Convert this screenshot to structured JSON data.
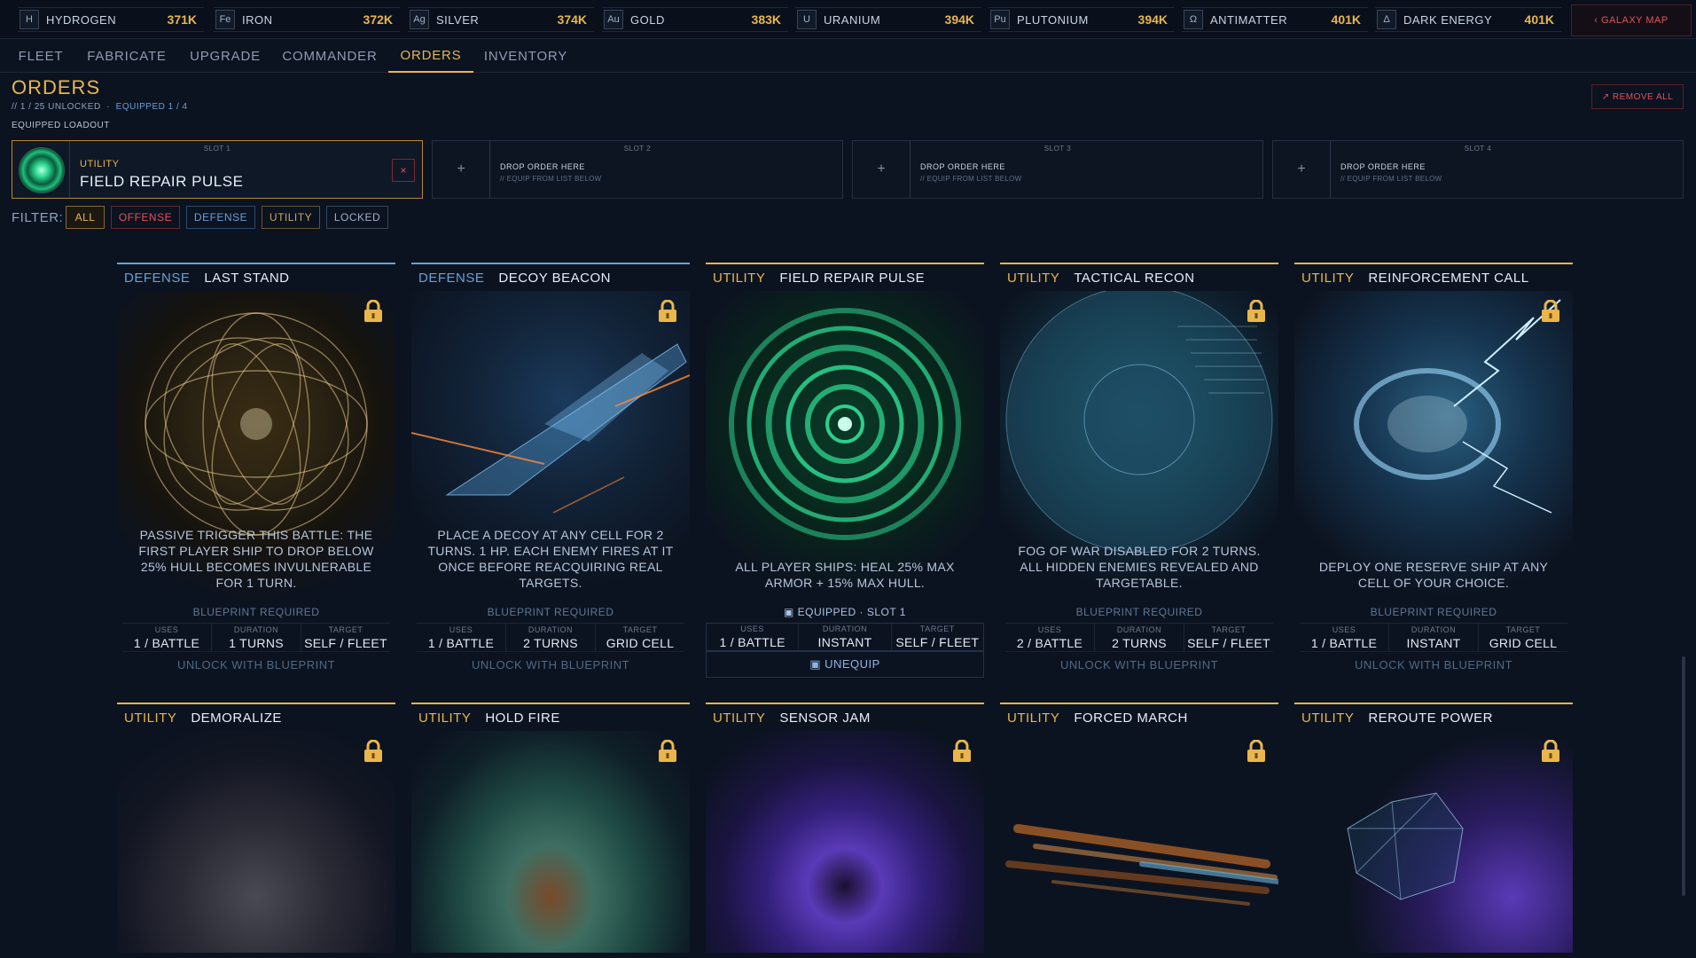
{
  "resources": [
    {
      "sym": "H",
      "name": "HYDROGEN",
      "value": "371K"
    },
    {
      "sym": "Fe",
      "name": "IRON",
      "value": "372K"
    },
    {
      "sym": "Ag",
      "name": "SILVER",
      "value": "374K"
    },
    {
      "sym": "Au",
      "name": "GOLD",
      "value": "383K"
    },
    {
      "sym": "U",
      "name": "URANIUM",
      "value": "394K"
    },
    {
      "sym": "Pu",
      "name": "PLUTONIUM",
      "value": "394K"
    },
    {
      "sym": "Ω",
      "name": "ANTIMATTER",
      "value": "401K"
    },
    {
      "sym": "Δ",
      "name": "DARK ENERGY",
      "value": "401K"
    }
  ],
  "galaxy_map_label": "‹ GALAXY MAP",
  "tabs": [
    "FLEET",
    "FABRICATE",
    "UPGRADE",
    "COMMANDER",
    "ORDERS",
    "INVENTORY"
  ],
  "active_tab": "ORDERS",
  "page": {
    "title": "ORDERS",
    "unlocked": "// 1 / 25 UNLOCKED",
    "sep": "·",
    "equipped": "EQUIPPED 1 / 4",
    "loadout_label": "EQUIPPED LOADOUT",
    "remove_all": "↗ REMOVE ALL"
  },
  "slots": [
    {
      "num": "SLOT 1",
      "type": "UTILITY",
      "name": "FIELD REPAIR PULSE",
      "remove": "×"
    },
    {
      "num": "SLOT 2",
      "plus": "+",
      "drop": "DROP ORDER HERE",
      "hint": "// EQUIP FROM LIST BELOW"
    },
    {
      "num": "SLOT 3",
      "plus": "+",
      "drop": "DROP ORDER HERE",
      "hint": "// EQUIP FROM LIST BELOW"
    },
    {
      "num": "SLOT 4",
      "plus": "+",
      "drop": "DROP ORDER HERE",
      "hint": "// EQUIP FROM LIST BELOW"
    }
  ],
  "filter": {
    "label": "FILTER:",
    "options": [
      "ALL",
      "OFFENSE",
      "DEFENSE",
      "UTILITY",
      "LOCKED"
    ],
    "active": "ALL"
  },
  "stat_labels": {
    "uses": "USES",
    "duration": "DURATION",
    "target": "TARGET"
  },
  "blueprint_required": "BLUEPRINT REQUIRED",
  "unlock_label": "UNLOCK WITH BLUEPRINT",
  "equipped_label": "▣ EQUIPPED · SLOT 1",
  "unequip_label": "▣ UNEQUIP",
  "colors": {
    "accent": "#e8b64c",
    "defense": "#6aa0d8",
    "utility": "#e8b64c",
    "danger": "#e0525c",
    "background": "#0b1220"
  },
  "cards_row1": [
    {
      "type": "DEFENSE",
      "title": "LAST STAND",
      "locked": true,
      "art": "golden-sphere",
      "desc": "PASSIVE TRIGGER THIS BATTLE: THE FIRST PLAYER SHIP TO DROP BELOW 25% HULL BECOMES INVULNERABLE FOR 1 TURN.",
      "uses": "1 / BATTLE",
      "duration": "1 TURNS",
      "target": "SELF / FLEET"
    },
    {
      "type": "DEFENSE",
      "title": "DECOY BEACON",
      "locked": true,
      "art": "holographic-ship",
      "desc": "PLACE A DECOY AT ANY CELL FOR 2 TURNS. 1 HP. EACH ENEMY FIRES AT IT ONCE BEFORE REACQUIRING REAL TARGETS.",
      "uses": "1 / BATTLE",
      "duration": "2 TURNS",
      "target": "GRID CELL"
    },
    {
      "type": "UTILITY",
      "title": "FIELD REPAIR PULSE",
      "locked": false,
      "equipped": true,
      "art": "green-pulse",
      "desc": "ALL PLAYER SHIPS: HEAL 25% MAX ARMOR + 15% MAX HULL.",
      "uses": "1 / BATTLE",
      "duration": "INSTANT",
      "target": "SELF / FLEET"
    },
    {
      "type": "UTILITY",
      "title": "TACTICAL RECON",
      "locked": true,
      "art": "data-sphere",
      "desc": "FOG OF WAR DISABLED FOR 2 TURNS. ALL HIDDEN ENEMIES REVEALED AND TARGETABLE.",
      "uses": "2 / BATTLE",
      "duration": "2 TURNS",
      "target": "SELF / FLEET"
    },
    {
      "type": "UTILITY",
      "title": "REINFORCEMENT CALL",
      "locked": true,
      "art": "lightning-vortex",
      "desc": "DEPLOY ONE RESERVE SHIP AT ANY CELL OF YOUR CHOICE.",
      "uses": "1 / BATTLE",
      "duration": "INSTANT",
      "target": "GRID CELL"
    }
  ],
  "cards_row2": [
    {
      "type": "UTILITY",
      "title": "DEMORALIZE",
      "locked": true,
      "art": "grey-nebula"
    },
    {
      "type": "UTILITY",
      "title": "HOLD FIRE",
      "locked": true,
      "art": "green-smoke"
    },
    {
      "type": "UTILITY",
      "title": "SENSOR JAM",
      "locked": true,
      "art": "purple-vortex"
    },
    {
      "type": "UTILITY",
      "title": "FORCED MARCH",
      "locked": true,
      "art": "speed-streaks"
    },
    {
      "type": "UTILITY",
      "title": "REROUTE POWER",
      "locked": true,
      "art": "wireframe-orb"
    }
  ]
}
